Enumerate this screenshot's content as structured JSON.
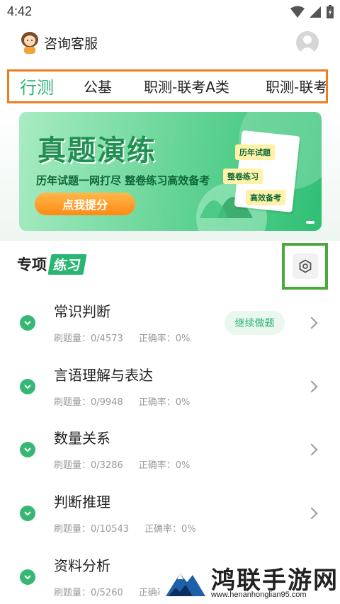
{
  "status_bar": {
    "time": "4:42"
  },
  "header": {
    "support_label": "咨询客服"
  },
  "tabs": [
    {
      "label": "行测",
      "active": true
    },
    {
      "label": "公基",
      "active": false
    },
    {
      "label": "职测-联考A类",
      "active": false
    },
    {
      "label": "职测-联考",
      "active": false
    }
  ],
  "banner": {
    "title": "真题演练",
    "subtitle": "历年试题一网打尽  整卷练习高效备考",
    "button_label": "点我提分",
    "tags": [
      "历年试题",
      "整卷练习",
      "高效备考"
    ]
  },
  "section": {
    "title_part1": "专项",
    "title_part2": "练习"
  },
  "practice_items": [
    {
      "name": "常识判断",
      "count_label": "刷题量：0/4573",
      "accuracy_label": "正确率：0%",
      "continue_label": "继续做题"
    },
    {
      "name": "言语理解与表达",
      "count_label": "刷题量：0/9948",
      "accuracy_label": "正确率：0%"
    },
    {
      "name": "数量关系",
      "count_label": "刷题量：0/3286",
      "accuracy_label": "正确率：0%"
    },
    {
      "name": "判断推理",
      "count_label": "刷题量：0/10543",
      "accuracy_label": "正确率：0%"
    },
    {
      "name": "资料分析",
      "count_label": "刷题量：0/5260",
      "accuracy_label": "正确率：0%"
    }
  ],
  "watermark": {
    "title": "鸿联手游网",
    "url": "www.henanhonglian95.com"
  },
  "colors": {
    "accent": "#2ab573",
    "tab_highlight_border": "#ee7d1e",
    "settings_highlight_border": "#4aa93b"
  }
}
